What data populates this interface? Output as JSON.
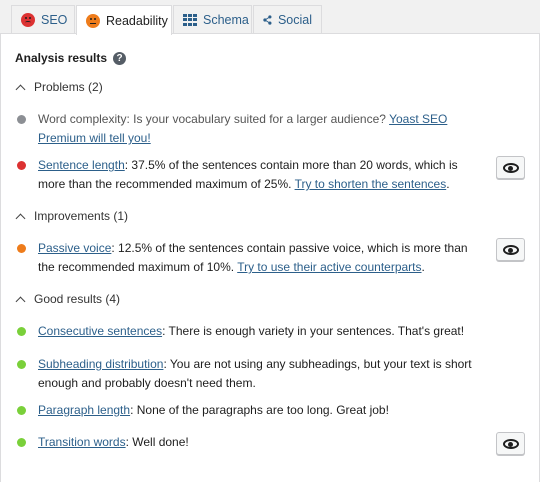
{
  "tabs": [
    {
      "label": "SEO",
      "icon": "sad-face-icon",
      "color": "#dc3232"
    },
    {
      "label": "Readability",
      "icon": "neutral-face-icon",
      "color": "#ee7c1b"
    },
    {
      "label": "Schema",
      "icon": "grid-icon"
    },
    {
      "label": "Social",
      "icon": "share-icon"
    }
  ],
  "heading": "Analysis results",
  "help_icon": "?",
  "sections": {
    "problems": "Problems (2)",
    "improvements": "Improvements (1)",
    "good": "Good results (4)"
  },
  "items": {
    "word_complexity": {
      "text": "Word complexity: Is your vocabulary suited for a larger audience? ",
      "link": "Yoast SEO Premium will tell you!",
      "color": "#8c8f94"
    },
    "sentence_length": {
      "link": "Sentence length",
      "text": ": 37.5% of the sentences contain more than 20 words, which is more than the recommended maximum of 25%. ",
      "link2": "Try to shorten the sentences",
      "after": ".",
      "color": "#dc3232"
    },
    "passive_voice": {
      "link": "Passive voice",
      "text": ": 12.5% of the sentences contain passive voice, which is more than the recommended maximum of 10%. ",
      "link2": "Try to use their active counterparts",
      "after": ".",
      "color": "#ee7c1b"
    },
    "consecutive": {
      "link": "Consecutive sentences",
      "text": ": There is enough variety in your sentences. That's great!",
      "color": "#7ad03a"
    },
    "subheading": {
      "link": "Subheading distribution",
      "text": ": You are not using any subheadings, but your text is short enough and probably doesn't need them.",
      "color": "#7ad03a"
    },
    "paragraph": {
      "link": "Paragraph length",
      "text": ": None of the paragraphs are too long. Great job!",
      "color": "#7ad03a"
    },
    "transition": {
      "link": "Transition words",
      "text": ": Well done!",
      "color": "#7ad03a"
    }
  }
}
